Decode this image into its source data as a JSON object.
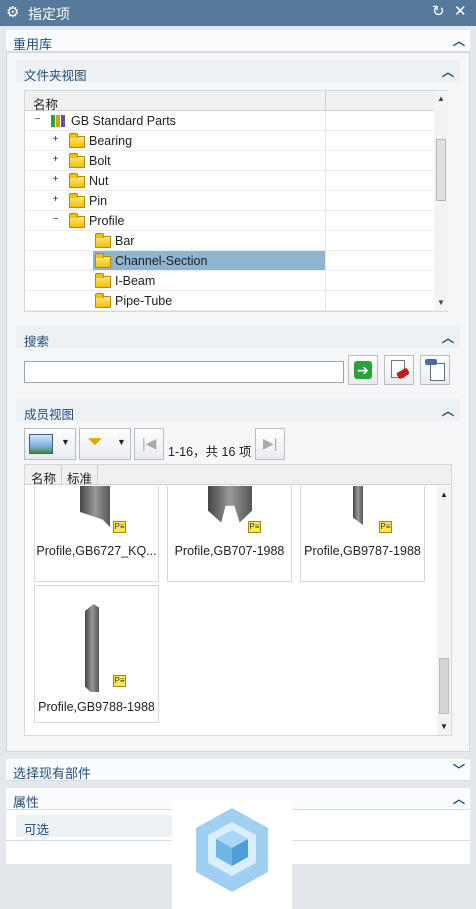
{
  "window": {
    "title": "指定项"
  },
  "reuse_library": {
    "label": "重用库"
  },
  "folder_view": {
    "label": "文件夹视图",
    "column_name": "名称",
    "tree": [
      {
        "label": "GB Standard Parts",
        "level": 0,
        "expander": "−"
      },
      {
        "label": "Bearing",
        "level": 1,
        "expander": "+"
      },
      {
        "label": "Bolt",
        "level": 1,
        "expander": "+"
      },
      {
        "label": "Nut",
        "level": 1,
        "expander": "+"
      },
      {
        "label": "Pin",
        "level": 1,
        "expander": "+"
      },
      {
        "label": "Profile",
        "level": 1,
        "expander": "−"
      },
      {
        "label": "Bar",
        "level": 2,
        "expander": ""
      },
      {
        "label": "Channel-Section",
        "level": 2,
        "expander": "",
        "selected": true
      },
      {
        "label": "I-Beam",
        "level": 2,
        "expander": ""
      },
      {
        "label": "Pipe-Tube",
        "level": 2,
        "expander": ""
      }
    ]
  },
  "search": {
    "label": "搜索",
    "value": ""
  },
  "member_view": {
    "label": "成员视图",
    "pager": "1-16，共 16 项",
    "columns": [
      "名称",
      "标准"
    ],
    "items": [
      {
        "caption": "Profile,GB6727_KQ..."
      },
      {
        "caption": "Profile,GB707-1988"
      },
      {
        "caption": "Profile,GB9787-1988"
      },
      {
        "caption": "Profile,GB9788-1988"
      }
    ],
    "tag_text": "P≡"
  },
  "select_existing": {
    "label": "选择现有部件"
  },
  "properties": {
    "label": "属性",
    "optional": "可选"
  },
  "colors": {
    "title_bar": "#57799c",
    "header_text": "#1f4e7a",
    "selection": "#8fb4cf"
  }
}
